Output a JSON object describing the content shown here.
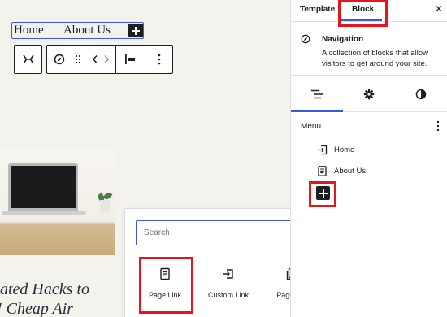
{
  "canvas": {
    "nav_links": [
      "Home",
      "About Us"
    ],
    "post_heading_lines": [
      "ated Hacks to",
      "! Cheap Air"
    ]
  },
  "sidebar": {
    "tabs": [
      "Template",
      "Block"
    ],
    "active_tab": "Block",
    "close_icon": "close-icon",
    "block_card": {
      "title": "Navigation",
      "description": "A collection of blocks that allow visitors to get around your site.",
      "icon": "compass-icon"
    },
    "subtabs": [
      "list-view-icon",
      "gear-icon",
      "contrast-icon"
    ],
    "menu": {
      "heading": "Menu",
      "items": [
        {
          "label": "Home",
          "icon": "login-arrow-icon"
        },
        {
          "label": "About Us",
          "icon": "page-icon"
        }
      ]
    }
  },
  "inserter": {
    "search_placeholder": "Search",
    "blocks": [
      {
        "label": "Page Link",
        "icon": "page-icon"
      },
      {
        "label": "Custom Link",
        "icon": "custom-link-icon"
      },
      {
        "label": "Page List",
        "icon": "page-list-icon"
      }
    ]
  },
  "colors": {
    "accent": "#3858e9",
    "highlight": "#e2161d",
    "canvas_bg": "#f4f2ed",
    "dark": "#1e1e1e"
  }
}
